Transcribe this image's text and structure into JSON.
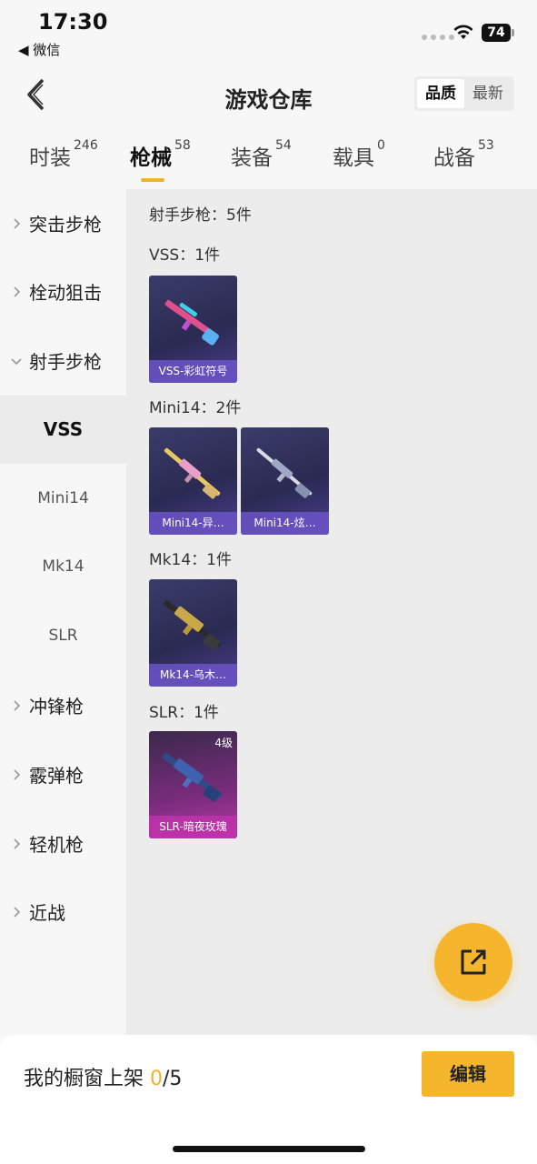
{
  "status_bar": {
    "time": "17:30",
    "back_app": "◀ 微信",
    "battery": "74"
  },
  "nav": {
    "title": "游戏仓库",
    "sort_options": [
      "品质",
      "最新"
    ],
    "sort_selected": "品质"
  },
  "tabs": [
    {
      "label": "时装",
      "count": "246"
    },
    {
      "label": "枪械",
      "count": "58",
      "active": true
    },
    {
      "label": "装备",
      "count": "54"
    },
    {
      "label": "载具",
      "count": "0"
    },
    {
      "label": "战备",
      "count": "53"
    }
  ],
  "sidebar": {
    "categories": [
      {
        "label": "突击步枪"
      },
      {
        "label": "栓动狙击"
      },
      {
        "label": "射手步枪",
        "expanded": true
      }
    ],
    "subcategories": [
      {
        "label": "VSS",
        "active": true
      },
      {
        "label": "Mini14"
      },
      {
        "label": "Mk14"
      },
      {
        "label": "SLR"
      }
    ],
    "more_categories": [
      {
        "label": "冲锋枪"
      },
      {
        "label": "霰弹枪"
      },
      {
        "label": "轻机枪"
      },
      {
        "label": "近战"
      }
    ]
  },
  "content": {
    "header": "射手步枪：5件",
    "groups": [
      {
        "title": "VSS：1件",
        "items": [
          {
            "caption": "VSS-彩虹符号"
          }
        ]
      },
      {
        "title": "Mini14：2件",
        "items": [
          {
            "caption": "Mini14-异…"
          },
          {
            "caption": "Mini14-炫…"
          }
        ]
      },
      {
        "title": "Mk14：1件",
        "items": [
          {
            "caption": "Mk14-乌木…"
          }
        ]
      },
      {
        "title": "SLR：1件",
        "items": [
          {
            "caption": "SLR-暗夜玫瑰",
            "level": "4级"
          }
        ]
      }
    ]
  },
  "bottom": {
    "shelf_label": "我的橱窗上架 ",
    "shelf_used": "0",
    "shelf_total": "/5",
    "edit_label": "编辑"
  },
  "colors": {
    "accent": "#f5b62e",
    "card_purple": "#2a2a52",
    "card_pink": "#b33aa6"
  }
}
